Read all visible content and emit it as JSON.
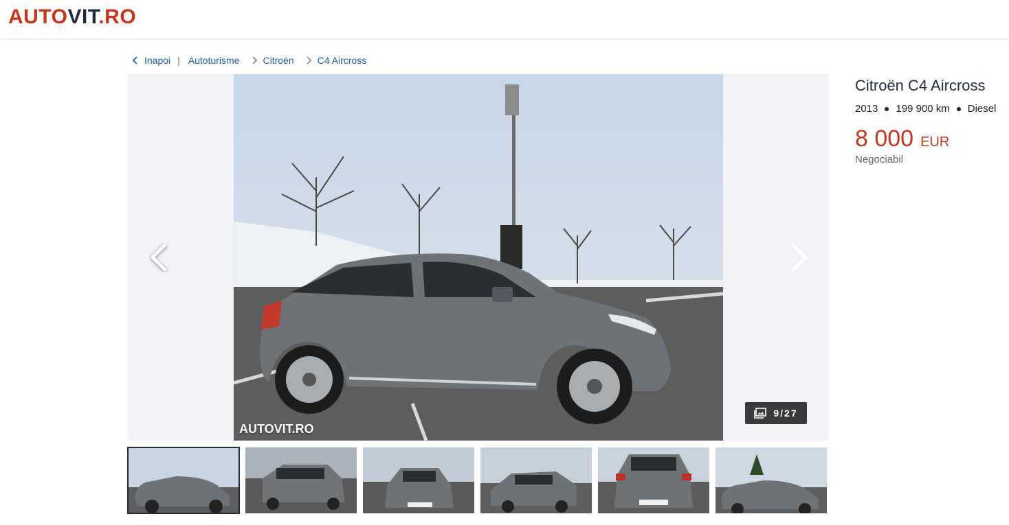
{
  "header": {
    "logo": {
      "part1": "AUTO",
      "part2": "VIT",
      "part3": ".RO"
    }
  },
  "breadcrumb": {
    "back": "Inapoi",
    "separator": "|",
    "items": [
      "Autoturisme",
      "Citroën",
      "C4 Aircross"
    ]
  },
  "gallery": {
    "watermark": "AUTOVIT.RO",
    "counter": "9/27",
    "thumbnails_count": 6,
    "active_thumbnail": 1
  },
  "listing": {
    "title": "Citroën C4 Aircross",
    "year": "2013",
    "mileage": "199 900 km",
    "fuel": "Diesel",
    "price": "8 000",
    "currency": "EUR",
    "negotiable": "Negociabil"
  },
  "colors": {
    "brand_red": "#c8341c",
    "brand_navy": "#1f2b3d",
    "link_blue": "#1b5fa8",
    "car_grey": "#6e7378"
  },
  "icons": [
    "chevron-left-icon",
    "chevron-right-icon",
    "gallery-icon"
  ]
}
